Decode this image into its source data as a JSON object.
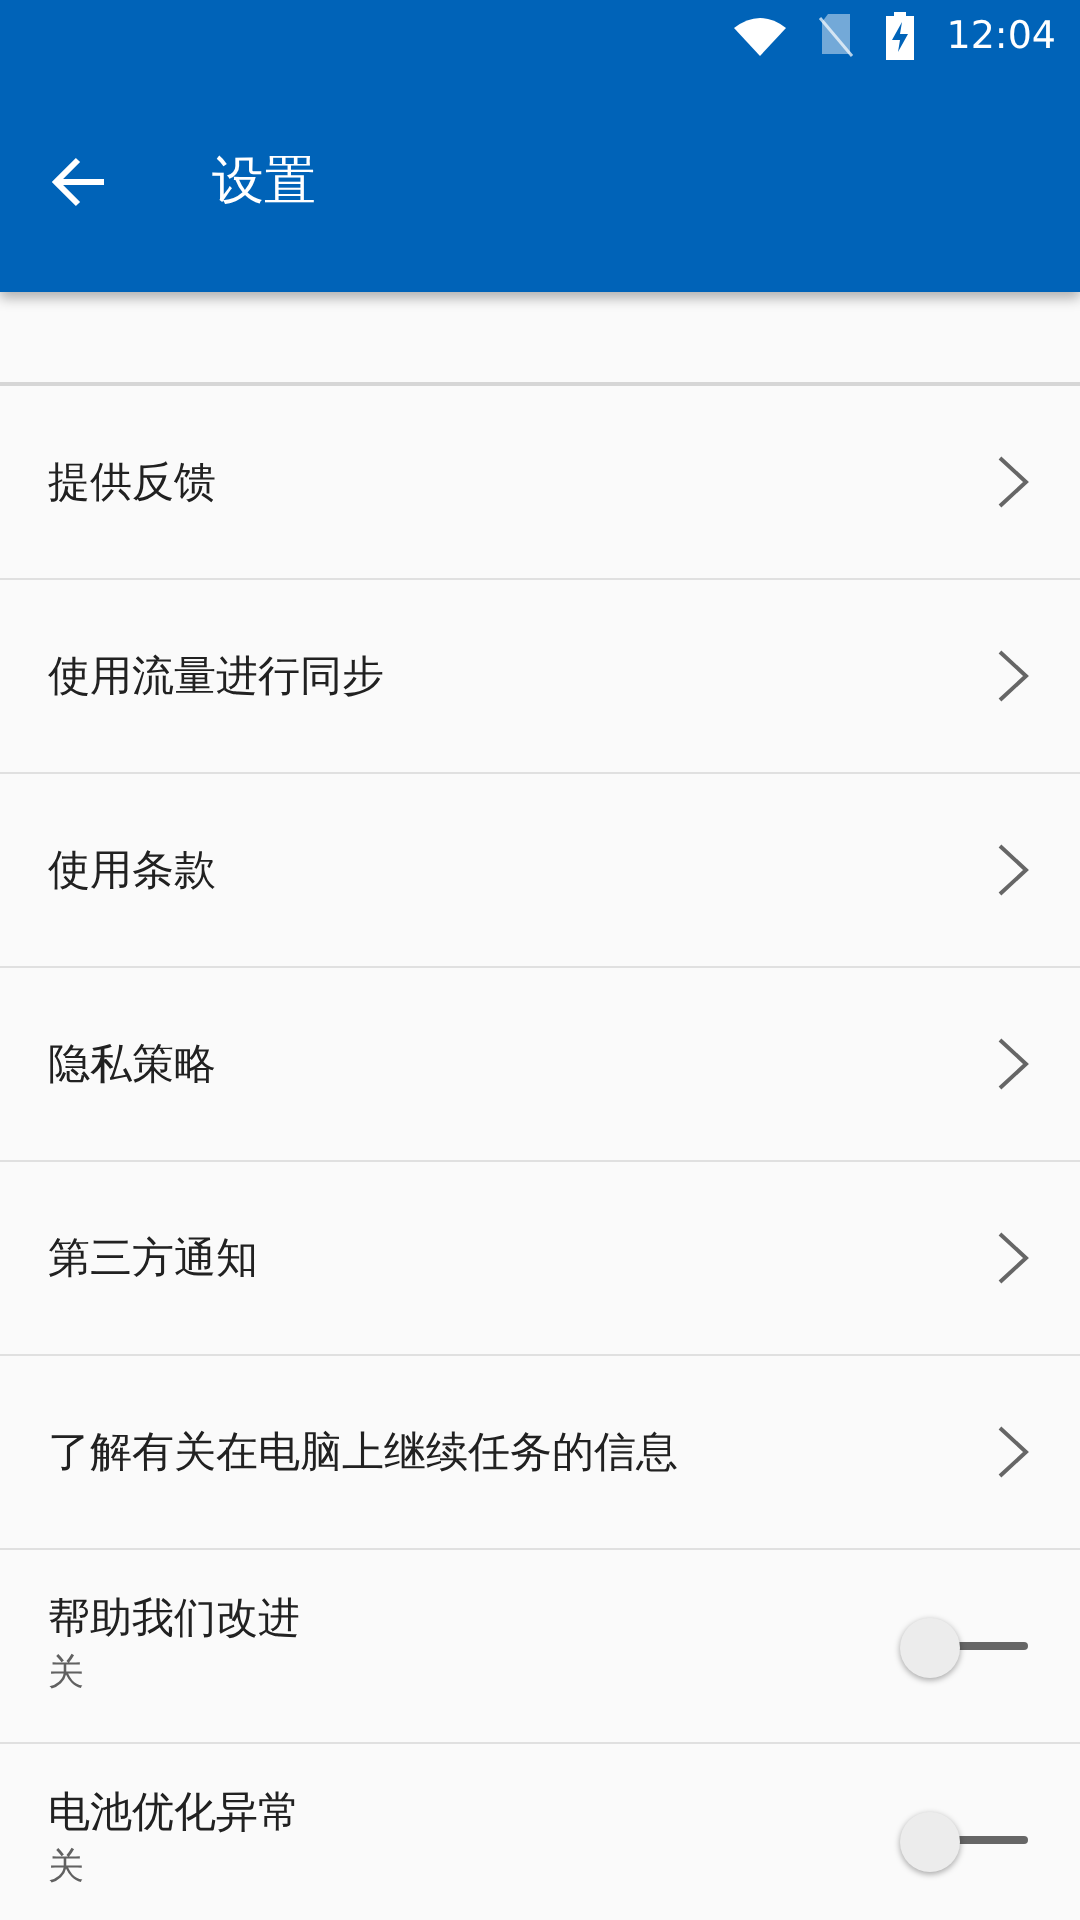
{
  "status_bar": {
    "time": "12:04"
  },
  "app_bar": {
    "title": "设置"
  },
  "items": [
    {
      "kind": "link",
      "label": "提供反馈"
    },
    {
      "kind": "link",
      "label": "使用流量进行同步"
    },
    {
      "kind": "link",
      "label": "使用条款"
    },
    {
      "kind": "link",
      "label": "隐私策略"
    },
    {
      "kind": "link",
      "label": "第三方通知"
    },
    {
      "kind": "link",
      "label": "了解有关在电脑上继续任务的信息"
    },
    {
      "kind": "switch",
      "label": "帮助我们改进",
      "summary": "关",
      "on": false
    },
    {
      "kind": "switch",
      "label": "电池优化异常",
      "summary": "关",
      "on": false
    }
  ]
}
